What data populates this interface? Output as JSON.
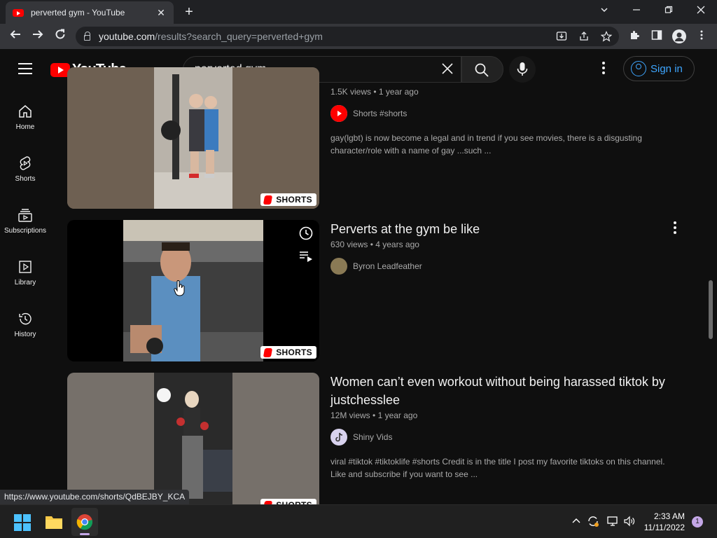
{
  "browser": {
    "tab_title": "perverted gym - YouTube",
    "tab_close": "✕",
    "new_tab": "+",
    "url_host": "youtube.com",
    "url_path": "/results?search_query=perverted+gym",
    "status_link": "https://www.youtube.com/shorts/QdBEJBY_KCA"
  },
  "header": {
    "logo_text": "YouTube",
    "search_value": "perverted gym",
    "signin_label": "Sign in"
  },
  "sidebar": {
    "items": [
      {
        "label": "Home"
      },
      {
        "label": "Shorts"
      },
      {
        "label": "Subscriptions"
      },
      {
        "label": "Library"
      },
      {
        "label": "History"
      }
    ]
  },
  "results": [
    {
      "title": "",
      "views": "1.5K views",
      "age": "1 year ago",
      "channel": "Shorts #shorts",
      "description": "gay(lgbt) is now become a legal and in trend if you see movies, there is a disgusting character/role with a name of gay ...such ...",
      "badge": "SHORTS"
    },
    {
      "title": "Perverts at the gym be like",
      "views": "630 views",
      "age": "4 years ago",
      "channel": "Byron Leadfeather",
      "description": "",
      "badge": "SHORTS"
    },
    {
      "title": "Women can’t even workout without being harassed tiktok by justchesslee",
      "views": "12M views",
      "age": "1 year ago",
      "channel": "Shiny Vids",
      "description": "viral #tiktok #tiktoklife #shorts Credit is in the title I post my favorite tiktoks on this channel. Like and subscribe if you want to see ...",
      "badge": "SHORTS"
    }
  ],
  "taskbar": {
    "time": "2:33 AM",
    "date": "11/11/2022",
    "notification_count": "1"
  },
  "colors": {
    "accent_red": "#ff0000",
    "link_blue": "#3ea6ff",
    "background": "#0f0f0f"
  }
}
